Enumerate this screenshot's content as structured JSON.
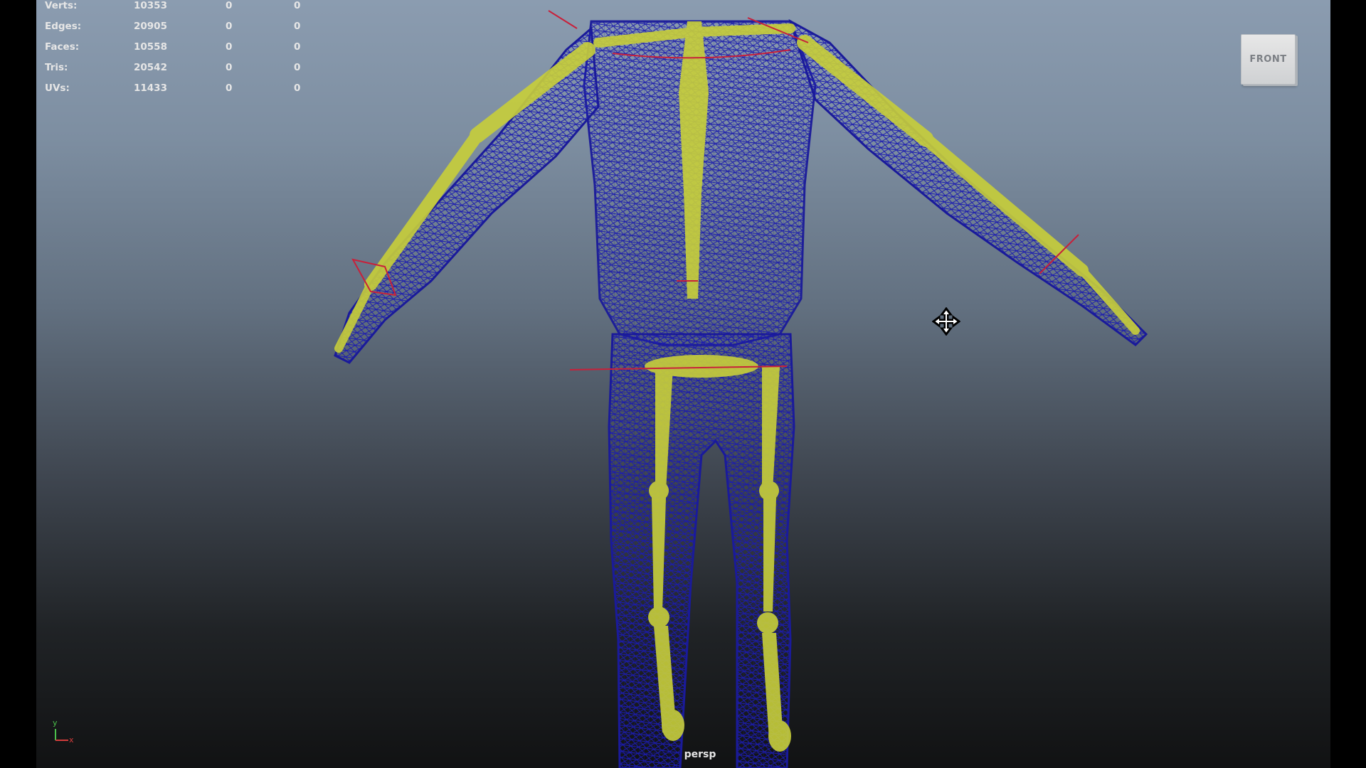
{
  "stats": [
    {
      "label": "Verts:",
      "total": "10353",
      "selected": "0",
      "components": "0"
    },
    {
      "label": "Edges:",
      "total": "20905",
      "selected": "0",
      "components": "0"
    },
    {
      "label": "Faces:",
      "total": "10558",
      "selected": "0",
      "components": "0"
    },
    {
      "label": "Tris:",
      "total": "20542",
      "selected": "0",
      "components": "0"
    },
    {
      "label": "UVs:",
      "total": "11433",
      "selected": "0",
      "components": "0"
    }
  ],
  "viewcube": {
    "label": "FRONT"
  },
  "camera": {
    "label": "persp"
  },
  "axis": {
    "y_label": "y",
    "x_label": "x"
  },
  "icons": {
    "cursor": "move-cursor-icon",
    "gizmo": "axis-gizmo-icon"
  },
  "colors": {
    "wireframe": "#1c1cb0",
    "skeleton": "#c8cf3a",
    "joint_lines": "#c8203a"
  }
}
